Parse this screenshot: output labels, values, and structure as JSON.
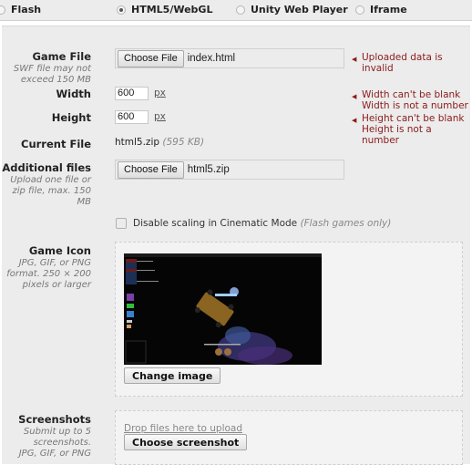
{
  "platform_options": [
    {
      "label": "Flash",
      "checked": false
    },
    {
      "label": "HTML5/WebGL",
      "checked": true
    },
    {
      "label": "Unity Web Player",
      "checked": false
    },
    {
      "label": "Iframe",
      "checked": false
    }
  ],
  "game_file": {
    "label": "Game File",
    "hint": "SWF file may not exceed 150 MB",
    "button": "Choose File",
    "filename": "index.html",
    "error": "Uploaded data is invalid"
  },
  "width": {
    "label": "Width",
    "value": "600",
    "unit": "px",
    "errors": [
      "Width can't be blank",
      "Width is not a number"
    ]
  },
  "height": {
    "label": "Height",
    "value": "600",
    "unit": "px",
    "errors": [
      "Height can't be blank",
      "Height is not a number"
    ]
  },
  "current_file": {
    "label": "Current File",
    "name": "html5.zip",
    "size": "(595 KB)"
  },
  "additional_files": {
    "label": "Additional files",
    "hint": "Upload one file or zip file, max. 150 MB",
    "button": "Choose File",
    "filename": "html5.zip"
  },
  "cinematic": {
    "label": "Disable scaling in Cinematic Mode",
    "note": "(Flash games only)",
    "checked": false
  },
  "game_icon": {
    "label": "Game Icon",
    "hint": "JPG, GIF, or PNG format. 250 × 200 pixels or larger",
    "button": "Change image"
  },
  "screenshots": {
    "label": "Screenshots",
    "hint": "Submit up to 5 screenshots. JPG, GIF, or PNG",
    "drop_text": "Drop files here to upload",
    "button": "Choose screenshot"
  },
  "colors": {
    "error": "#8b1a1a",
    "panel": "#ececec"
  }
}
